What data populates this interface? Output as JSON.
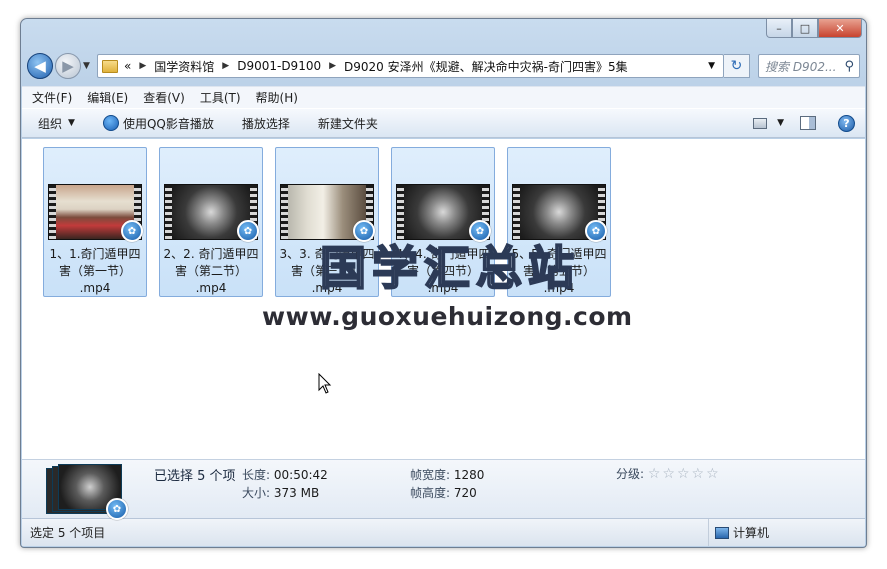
{
  "window": {
    "caption_buttons": {
      "minimize": "–",
      "maximize": "□",
      "close": "✕"
    }
  },
  "nav": {
    "back_glyph": "◀",
    "forward_glyph": "▶",
    "breadcrumbs": [
      "«",
      "国学资料馆",
      "D9001-D9100",
      "D9020 安泽州《规避、解决命中灾祸-奇门四害》5集"
    ],
    "search_placeholder": "搜索 D902..."
  },
  "menu": [
    "文件(F)",
    "编辑(E)",
    "查看(V)",
    "工具(T)",
    "帮助(H)"
  ],
  "commands": {
    "organize": "组织",
    "play_qq": "使用QQ影音播放",
    "play_selection": "播放选择",
    "new_folder": "新建文件夹"
  },
  "files": [
    {
      "name": "1、1.奇门遁甲四害（第一节）.mp4",
      "line1": "1、1.奇门遁甲四",
      "line2": "害（第一节）",
      "line3": ".mp4",
      "frame": "class"
    },
    {
      "name": "2、2. 奇门遁甲四害（第二节）.mp4",
      "line1": "2、2. 奇门遁甲四",
      "line2": "害（第二节）",
      "line3": ".mp4",
      "frame": "dark"
    },
    {
      "name": "3、3. 奇门遁甲四害（第三节）.mp4",
      "line1": "3、3. 奇门遁甲四",
      "line2": "害（第三节）",
      "line3": ".mp4",
      "frame": "room"
    },
    {
      "name": "4、4. 奇门遁甲四害（第四节）.mp4",
      "line1": "4、4. 奇门遁甲四",
      "line2": "害（第四节）",
      "line3": ".mp4",
      "frame": "dark"
    },
    {
      "name": "5、5. 奇门遁甲四害（第五节）.mp4",
      "line1": "5、5. 奇门遁甲四",
      "line2": "害（第五节）",
      "line3": ".mp4",
      "frame": "dark"
    }
  ],
  "watermark": {
    "cn": "国学汇总站",
    "url": "www.guoxuehuizong.com"
  },
  "details": {
    "selected": "已选择 5 个项",
    "length_label": "长度:",
    "length_value": "00:50:42",
    "size_label": "大小:",
    "size_value": "373 MB",
    "frame_width_label": "帧宽度:",
    "frame_width_value": "1280",
    "frame_height_label": "帧高度:",
    "frame_height_value": "720",
    "rating_label": "分级:",
    "rating_stars": "☆☆☆☆☆"
  },
  "status": {
    "left": "选定 5 个项目",
    "right": "计算机"
  }
}
